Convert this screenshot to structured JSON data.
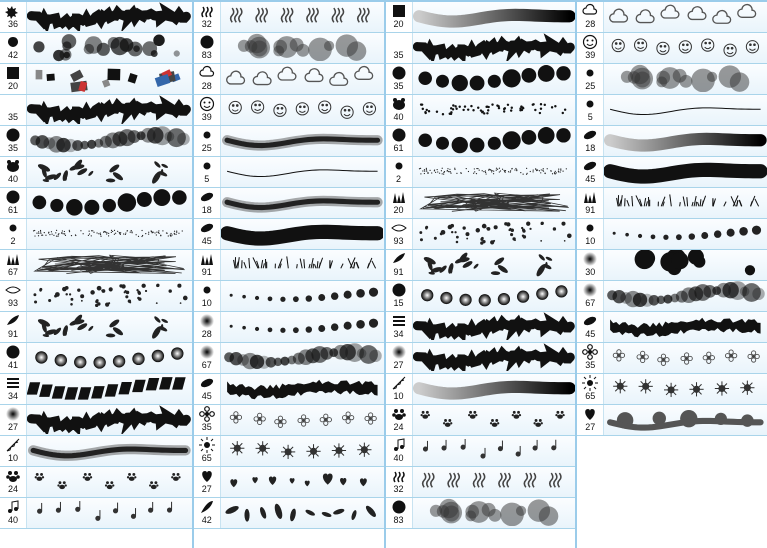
{
  "columns": [
    [
      {
        "size": 36,
        "tip": "splat",
        "demo": "rough"
      },
      {
        "size": 42,
        "tip": "blot",
        "demo": "blotchy"
      },
      {
        "size": 20,
        "tip": "square",
        "demo": "boxes"
      },
      {
        "size": 35,
        "tip": "moon",
        "demo": "rough"
      },
      {
        "size": 35,
        "tip": "ball",
        "demo": "cloudy"
      },
      {
        "size": 40,
        "tip": "pig",
        "demo": "leaves"
      },
      {
        "size": 61,
        "tip": "ball",
        "demo": "bigdots"
      },
      {
        "size": 2,
        "tip": "dot",
        "demo": "fine"
      },
      {
        "size": 67,
        "tip": "grass",
        "demo": "scribble"
      },
      {
        "size": 93,
        "tip": "wind",
        "demo": "scatter"
      },
      {
        "size": 91,
        "tip": "leaves",
        "demo": "leaves"
      },
      {
        "size": 41,
        "tip": "ball",
        "demo": "balls"
      },
      {
        "size": 34,
        "tip": "stack",
        "demo": "stack"
      },
      {
        "size": 27,
        "tip": "glow",
        "demo": "rough"
      },
      {
        "size": 10,
        "tip": "feather",
        "demo": "soft"
      },
      {
        "size": 24,
        "tip": "paw",
        "demo": "paws"
      },
      {
        "size": 40,
        "tip": "notes",
        "demo": "notes"
      }
    ],
    [
      {
        "size": 32,
        "tip": "steam",
        "demo": "steam"
      },
      {
        "size": 83,
        "tip": "ball",
        "demo": "cloud"
      },
      {
        "size": 28,
        "tip": "cloud",
        "demo": "clouds"
      },
      {
        "size": 39,
        "tip": "smiley",
        "demo": "smileys"
      },
      {
        "size": 25,
        "tip": "dot",
        "demo": "soft"
      },
      {
        "size": 5,
        "tip": "dot",
        "demo": "thin"
      },
      {
        "size": 18,
        "tip": "ellipse",
        "demo": "soft"
      },
      {
        "size": 45,
        "tip": "ellipse",
        "demo": "broad"
      },
      {
        "size": 91,
        "tip": "grass",
        "demo": "grassy"
      },
      {
        "size": 10,
        "tip": "dot",
        "demo": "dotrow"
      },
      {
        "size": 28,
        "tip": "glow",
        "demo": "dotrow"
      },
      {
        "size": 67,
        "tip": "glow",
        "demo": "cloudy"
      },
      {
        "size": 45,
        "tip": "ellipse",
        "demo": "ragged"
      },
      {
        "size": 35,
        "tip": "flower",
        "demo": "flowers"
      },
      {
        "size": 65,
        "tip": "sun",
        "demo": "suns"
      },
      {
        "size": 27,
        "tip": "heart",
        "demo": "hearts"
      },
      {
        "size": 42,
        "tip": "leaf",
        "demo": "leafrow"
      }
    ],
    [
      {
        "size": 20,
        "tip": "square",
        "demo": "grad"
      },
      {
        "size": 35,
        "tip": "moon",
        "demo": "rough"
      },
      {
        "size": 35,
        "tip": "ball",
        "demo": "bigdots"
      },
      {
        "size": 40,
        "tip": "pig",
        "demo": "stipple"
      },
      {
        "size": 61,
        "tip": "ball",
        "demo": "bigdots"
      },
      {
        "size": 2,
        "tip": "dot",
        "demo": "fine"
      },
      {
        "size": 20,
        "tip": "grass",
        "demo": "scribble"
      },
      {
        "size": 93,
        "tip": "wind",
        "demo": "scatter"
      },
      {
        "size": 91,
        "tip": "leaves",
        "demo": "leaves"
      },
      {
        "size": 15,
        "tip": "ball",
        "demo": "balls"
      },
      {
        "size": 34,
        "tip": "stack",
        "demo": "rough"
      },
      {
        "size": 27,
        "tip": "glow",
        "demo": "rough"
      },
      {
        "size": 10,
        "tip": "feather",
        "demo": "grad"
      },
      {
        "size": 24,
        "tip": "paw",
        "demo": "paws"
      },
      {
        "size": 40,
        "tip": "notes",
        "demo": "notes"
      },
      {
        "size": 32,
        "tip": "steam",
        "demo": "steam"
      },
      {
        "size": 83,
        "tip": "ball",
        "demo": "cloud"
      }
    ],
    [
      {
        "size": 28,
        "tip": "cloud",
        "demo": "clouds"
      },
      {
        "size": 39,
        "tip": "smiley",
        "demo": "smileys"
      },
      {
        "size": 25,
        "tip": "dot",
        "demo": "cloud"
      },
      {
        "size": 5,
        "tip": "dot",
        "demo": "thin"
      },
      {
        "size": 18,
        "tip": "ellipse",
        "demo": "grad"
      },
      {
        "size": 45,
        "tip": "ellipse",
        "demo": "broad"
      },
      {
        "size": 91,
        "tip": "grass",
        "demo": "grassy"
      },
      {
        "size": 10,
        "tip": "dot",
        "demo": "dotrow"
      },
      {
        "size": 30,
        "tip": "glow",
        "demo": "bigrand"
      },
      {
        "size": 67,
        "tip": "glow",
        "demo": "cloudy"
      },
      {
        "size": 45,
        "tip": "ellipse",
        "demo": "ragged"
      },
      {
        "size": 35,
        "tip": "flower",
        "demo": "flowers"
      },
      {
        "size": 65,
        "tip": "sun",
        "demo": "suns"
      },
      {
        "size": 27,
        "tip": "heart",
        "demo": "splash"
      }
    ]
  ]
}
